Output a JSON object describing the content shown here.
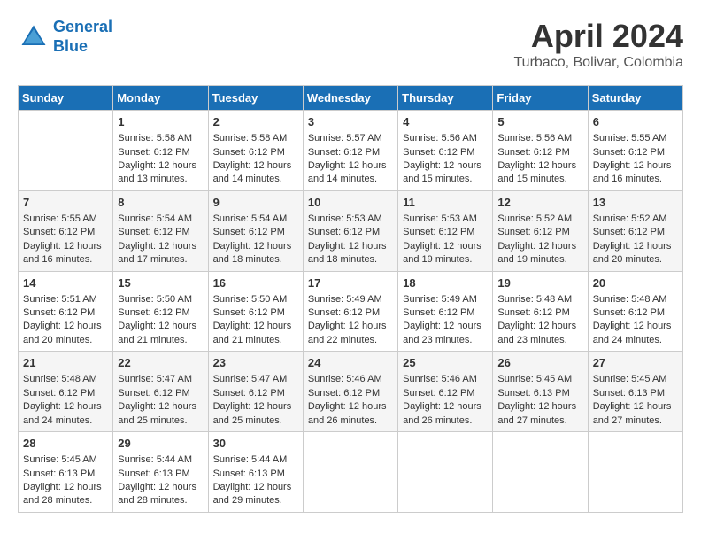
{
  "header": {
    "logo_line1": "General",
    "logo_line2": "Blue",
    "month_title": "April 2024",
    "location": "Turbaco, Bolivar, Colombia"
  },
  "days_of_week": [
    "Sunday",
    "Monday",
    "Tuesday",
    "Wednesday",
    "Thursday",
    "Friday",
    "Saturday"
  ],
  "weeks": [
    [
      {
        "day": "",
        "sunrise": "",
        "sunset": "",
        "daylight": ""
      },
      {
        "day": "1",
        "sunrise": "Sunrise: 5:58 AM",
        "sunset": "Sunset: 6:12 PM",
        "daylight": "Daylight: 12 hours and 13 minutes."
      },
      {
        "day": "2",
        "sunrise": "Sunrise: 5:58 AM",
        "sunset": "Sunset: 6:12 PM",
        "daylight": "Daylight: 12 hours and 14 minutes."
      },
      {
        "day": "3",
        "sunrise": "Sunrise: 5:57 AM",
        "sunset": "Sunset: 6:12 PM",
        "daylight": "Daylight: 12 hours and 14 minutes."
      },
      {
        "day": "4",
        "sunrise": "Sunrise: 5:56 AM",
        "sunset": "Sunset: 6:12 PM",
        "daylight": "Daylight: 12 hours and 15 minutes."
      },
      {
        "day": "5",
        "sunrise": "Sunrise: 5:56 AM",
        "sunset": "Sunset: 6:12 PM",
        "daylight": "Daylight: 12 hours and 15 minutes."
      },
      {
        "day": "6",
        "sunrise": "Sunrise: 5:55 AM",
        "sunset": "Sunset: 6:12 PM",
        "daylight": "Daylight: 12 hours and 16 minutes."
      }
    ],
    [
      {
        "day": "7",
        "sunrise": "Sunrise: 5:55 AM",
        "sunset": "Sunset: 6:12 PM",
        "daylight": "Daylight: 12 hours and 16 minutes."
      },
      {
        "day": "8",
        "sunrise": "Sunrise: 5:54 AM",
        "sunset": "Sunset: 6:12 PM",
        "daylight": "Daylight: 12 hours and 17 minutes."
      },
      {
        "day": "9",
        "sunrise": "Sunrise: 5:54 AM",
        "sunset": "Sunset: 6:12 PM",
        "daylight": "Daylight: 12 hours and 18 minutes."
      },
      {
        "day": "10",
        "sunrise": "Sunrise: 5:53 AM",
        "sunset": "Sunset: 6:12 PM",
        "daylight": "Daylight: 12 hours and 18 minutes."
      },
      {
        "day": "11",
        "sunrise": "Sunrise: 5:53 AM",
        "sunset": "Sunset: 6:12 PM",
        "daylight": "Daylight: 12 hours and 19 minutes."
      },
      {
        "day": "12",
        "sunrise": "Sunrise: 5:52 AM",
        "sunset": "Sunset: 6:12 PM",
        "daylight": "Daylight: 12 hours and 19 minutes."
      },
      {
        "day": "13",
        "sunrise": "Sunrise: 5:52 AM",
        "sunset": "Sunset: 6:12 PM",
        "daylight": "Daylight: 12 hours and 20 minutes."
      }
    ],
    [
      {
        "day": "14",
        "sunrise": "Sunrise: 5:51 AM",
        "sunset": "Sunset: 6:12 PM",
        "daylight": "Daylight: 12 hours and 20 minutes."
      },
      {
        "day": "15",
        "sunrise": "Sunrise: 5:50 AM",
        "sunset": "Sunset: 6:12 PM",
        "daylight": "Daylight: 12 hours and 21 minutes."
      },
      {
        "day": "16",
        "sunrise": "Sunrise: 5:50 AM",
        "sunset": "Sunset: 6:12 PM",
        "daylight": "Daylight: 12 hours and 21 minutes."
      },
      {
        "day": "17",
        "sunrise": "Sunrise: 5:49 AM",
        "sunset": "Sunset: 6:12 PM",
        "daylight": "Daylight: 12 hours and 22 minutes."
      },
      {
        "day": "18",
        "sunrise": "Sunrise: 5:49 AM",
        "sunset": "Sunset: 6:12 PM",
        "daylight": "Daylight: 12 hours and 23 minutes."
      },
      {
        "day": "19",
        "sunrise": "Sunrise: 5:48 AM",
        "sunset": "Sunset: 6:12 PM",
        "daylight": "Daylight: 12 hours and 23 minutes."
      },
      {
        "day": "20",
        "sunrise": "Sunrise: 5:48 AM",
        "sunset": "Sunset: 6:12 PM",
        "daylight": "Daylight: 12 hours and 24 minutes."
      }
    ],
    [
      {
        "day": "21",
        "sunrise": "Sunrise: 5:48 AM",
        "sunset": "Sunset: 6:12 PM",
        "daylight": "Daylight: 12 hours and 24 minutes."
      },
      {
        "day": "22",
        "sunrise": "Sunrise: 5:47 AM",
        "sunset": "Sunset: 6:12 PM",
        "daylight": "Daylight: 12 hours and 25 minutes."
      },
      {
        "day": "23",
        "sunrise": "Sunrise: 5:47 AM",
        "sunset": "Sunset: 6:12 PM",
        "daylight": "Daylight: 12 hours and 25 minutes."
      },
      {
        "day": "24",
        "sunrise": "Sunrise: 5:46 AM",
        "sunset": "Sunset: 6:12 PM",
        "daylight": "Daylight: 12 hours and 26 minutes."
      },
      {
        "day": "25",
        "sunrise": "Sunrise: 5:46 AM",
        "sunset": "Sunset: 6:12 PM",
        "daylight": "Daylight: 12 hours and 26 minutes."
      },
      {
        "day": "26",
        "sunrise": "Sunrise: 5:45 AM",
        "sunset": "Sunset: 6:13 PM",
        "daylight": "Daylight: 12 hours and 27 minutes."
      },
      {
        "day": "27",
        "sunrise": "Sunrise: 5:45 AM",
        "sunset": "Sunset: 6:13 PM",
        "daylight": "Daylight: 12 hours and 27 minutes."
      }
    ],
    [
      {
        "day": "28",
        "sunrise": "Sunrise: 5:45 AM",
        "sunset": "Sunset: 6:13 PM",
        "daylight": "Daylight: 12 hours and 28 minutes."
      },
      {
        "day": "29",
        "sunrise": "Sunrise: 5:44 AM",
        "sunset": "Sunset: 6:13 PM",
        "daylight": "Daylight: 12 hours and 28 minutes."
      },
      {
        "day": "30",
        "sunrise": "Sunrise: 5:44 AM",
        "sunset": "Sunset: 6:13 PM",
        "daylight": "Daylight: 12 hours and 29 minutes."
      },
      {
        "day": "",
        "sunrise": "",
        "sunset": "",
        "daylight": ""
      },
      {
        "day": "",
        "sunrise": "",
        "sunset": "",
        "daylight": ""
      },
      {
        "day": "",
        "sunrise": "",
        "sunset": "",
        "daylight": ""
      },
      {
        "day": "",
        "sunrise": "",
        "sunset": "",
        "daylight": ""
      }
    ]
  ]
}
